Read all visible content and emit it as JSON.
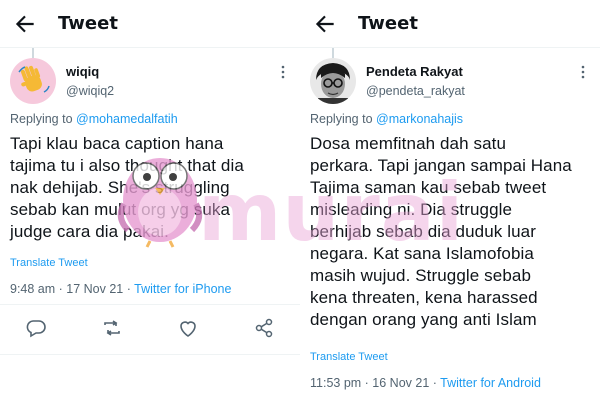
{
  "left": {
    "header_title": "Tweet",
    "author_name": "wiqiq",
    "author_handle": "@wiqiq2",
    "reply_prefix": "Replying to",
    "reply_mention": "@mohamedalfatih",
    "body_lines": [
      "Tapi klau baca caption hana",
      "tajima tu i also thought that dia",
      "nak dehijab. She's struggling",
      "sebab kan mulut org yg suka",
      "judge cara dia pakai."
    ],
    "translate": "Translate Tweet",
    "timestamp": "9:48 am · 17 Nov 21 ·",
    "source": "Twitter for iPhone",
    "avatar_icon": "waving-hand-icon",
    "action_icons": [
      "reply-icon",
      "retweet-icon",
      "like-icon",
      "share-icon"
    ]
  },
  "right": {
    "header_title": "Tweet",
    "author_name": "Pendeta Rakyat",
    "author_handle": "@pendeta_rakyat",
    "reply_prefix": "Replying to",
    "reply_mention": "@markonahajis",
    "body_lines": [
      "Dosa memfitnah dah satu",
      "perkara. Tapi jangan sampai Hana",
      "Tajima saman kau sebab tweet",
      "misleading ni. Dia struggle",
      "berhijab sebab dia duduk luar",
      "negara. Kat sana Islamofobia",
      "masih wujud. Struggle sebab",
      "kena threaten, kena harassed",
      "dengan orang yang anti Islam"
    ],
    "translate": "Translate Tweet",
    "timestamp": "11:53 pm · 16 Nov 21 ·",
    "source": "Twitter for Android"
  },
  "watermark": {
    "text": "murai"
  },
  "colors": {
    "link": "#1d9bf0",
    "muted": "#536471",
    "text": "#0f1419",
    "watermark": "#e9a4d6"
  }
}
